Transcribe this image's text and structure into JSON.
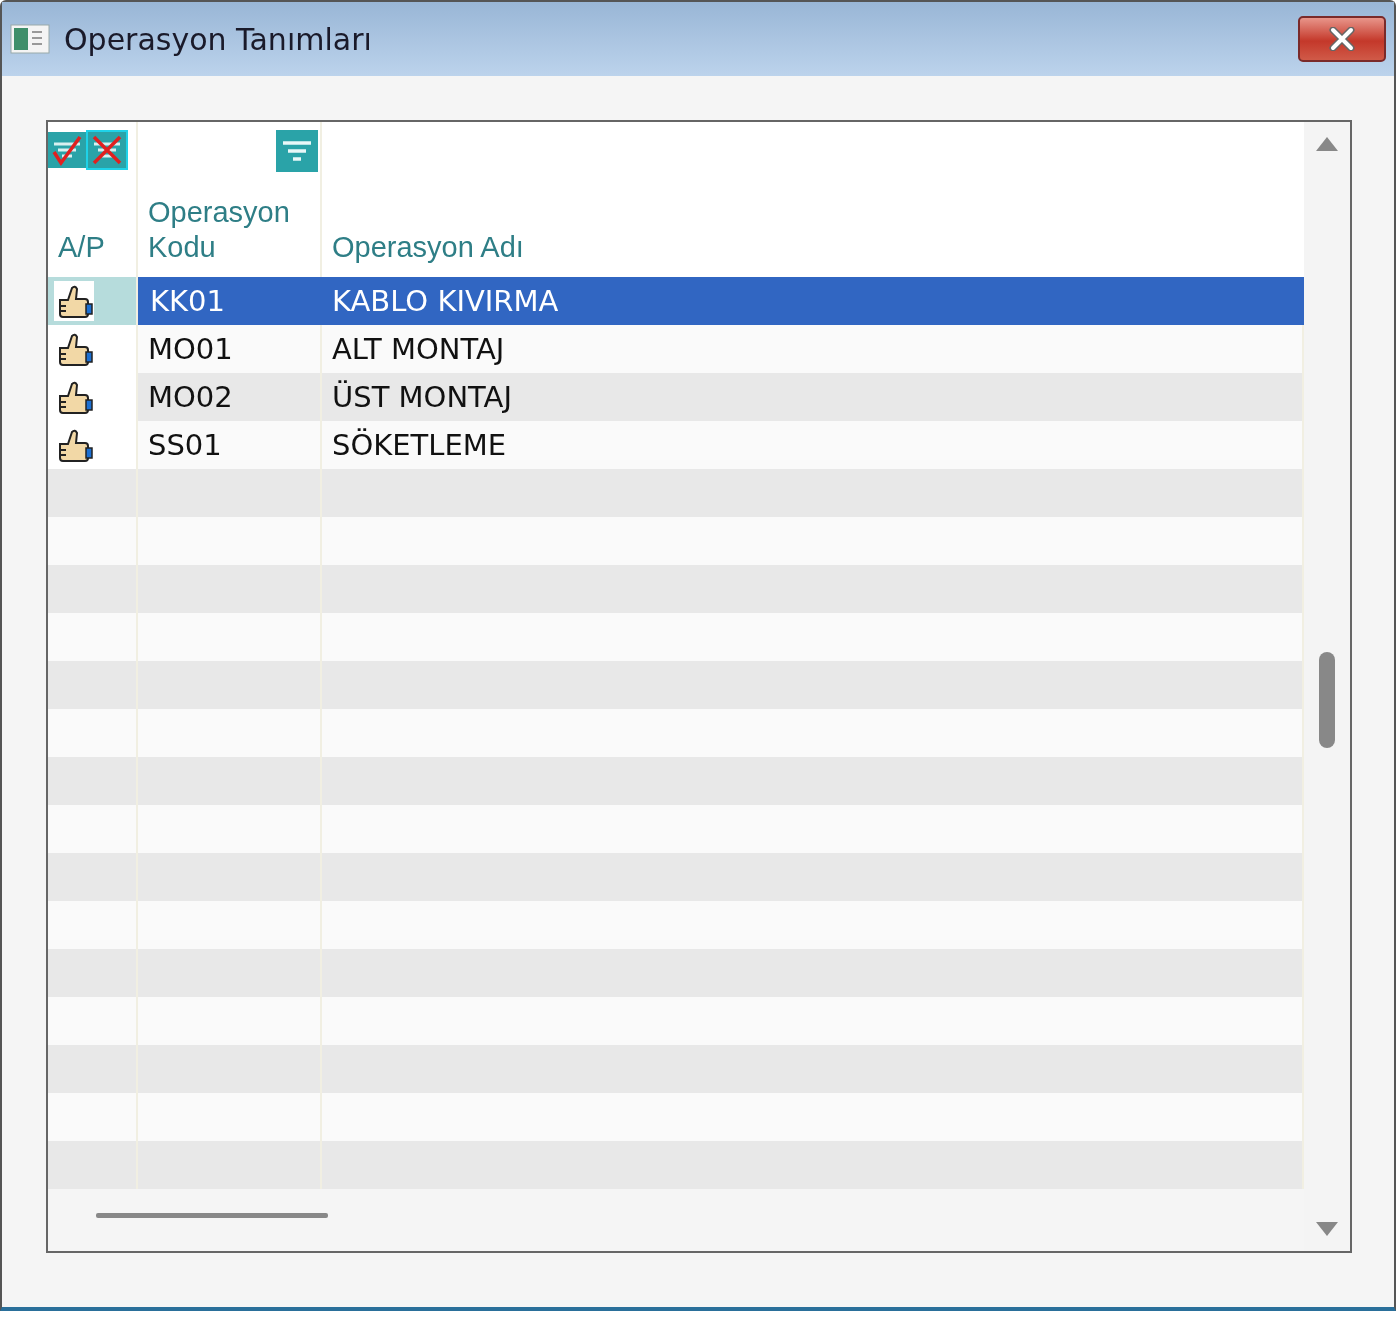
{
  "window": {
    "title": "Operasyon Tanımları"
  },
  "table": {
    "columns": [
      {
        "label": "A/P"
      },
      {
        "label": "Operasyon Kodu"
      },
      {
        "label": "Operasyon Adı"
      }
    ],
    "rows": [
      {
        "code": "KK01",
        "name": "KABLO KIVIRMA",
        "selected": true
      },
      {
        "code": "MO01",
        "name": "ALT MONTAJ",
        "selected": false
      },
      {
        "code": "MO02",
        "name": "ÜST MONTAJ",
        "selected": false
      },
      {
        "code": "SS01",
        "name": "SÖKETLEME",
        "selected": false
      }
    ]
  }
}
